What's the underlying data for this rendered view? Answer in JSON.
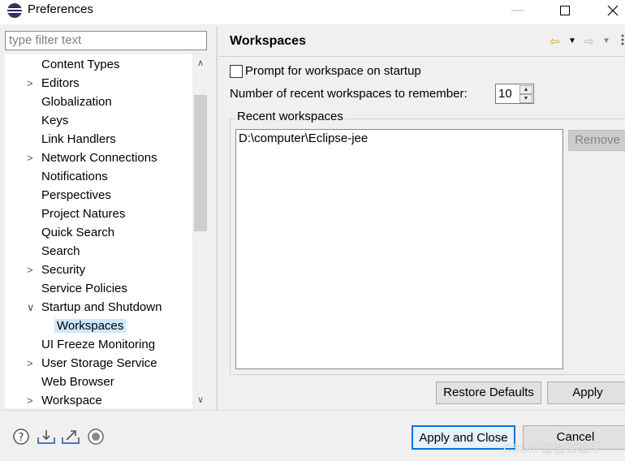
{
  "window": {
    "title": "Preferences"
  },
  "filter": {
    "placeholder": "type filter text"
  },
  "tree": {
    "items": [
      {
        "label": "Content Types",
        "expandable": false
      },
      {
        "label": "Editors",
        "expandable": true
      },
      {
        "label": "Globalization",
        "expandable": false
      },
      {
        "label": "Keys",
        "expandable": false
      },
      {
        "label": "Link Handlers",
        "expandable": false
      },
      {
        "label": "Network Connections",
        "expandable": true
      },
      {
        "label": "Notifications",
        "expandable": false
      },
      {
        "label": "Perspectives",
        "expandable": false
      },
      {
        "label": "Project Natures",
        "expandable": false
      },
      {
        "label": "Quick Search",
        "expandable": false
      },
      {
        "label": "Search",
        "expandable": false
      },
      {
        "label": "Security",
        "expandable": true
      },
      {
        "label": "Service Policies",
        "expandable": false
      },
      {
        "label": "Startup and Shutdown",
        "expandable": true,
        "expanded": true
      },
      {
        "label": "Workspaces",
        "child": true,
        "selected": true
      },
      {
        "label": "UI Freeze Monitoring",
        "expandable": false
      },
      {
        "label": "User Storage Service",
        "expandable": true
      },
      {
        "label": "Web Browser",
        "expandable": false
      },
      {
        "label": "Workspace",
        "expandable": true
      }
    ]
  },
  "page": {
    "title": "Workspaces",
    "prompt_label": "Prompt for workspace on startup",
    "prompt_checked": false,
    "num_label": "Number of recent workspaces to remember:",
    "num_value": "10",
    "recent_group_label": "Recent workspaces",
    "recent_items": [
      "D:\\computer\\Eclipse-jee"
    ],
    "remove_label": "Remove",
    "restore_label": "Restore Defaults",
    "apply_label": "Apply"
  },
  "footer": {
    "apply_close_label": "Apply and Close",
    "cancel_label": "Cancel",
    "watermark": "CSDN @憨憨憨羊"
  },
  "colors": {
    "selection": "#cce8ff",
    "default_button_border": "#0078d7",
    "eclipse_icon": "#2c2255"
  },
  "icons": [
    "help-icon",
    "import-icon",
    "export-icon",
    "record-icon",
    "back-arrow-icon",
    "forward-arrow-icon",
    "menu-chevron-icon"
  ]
}
